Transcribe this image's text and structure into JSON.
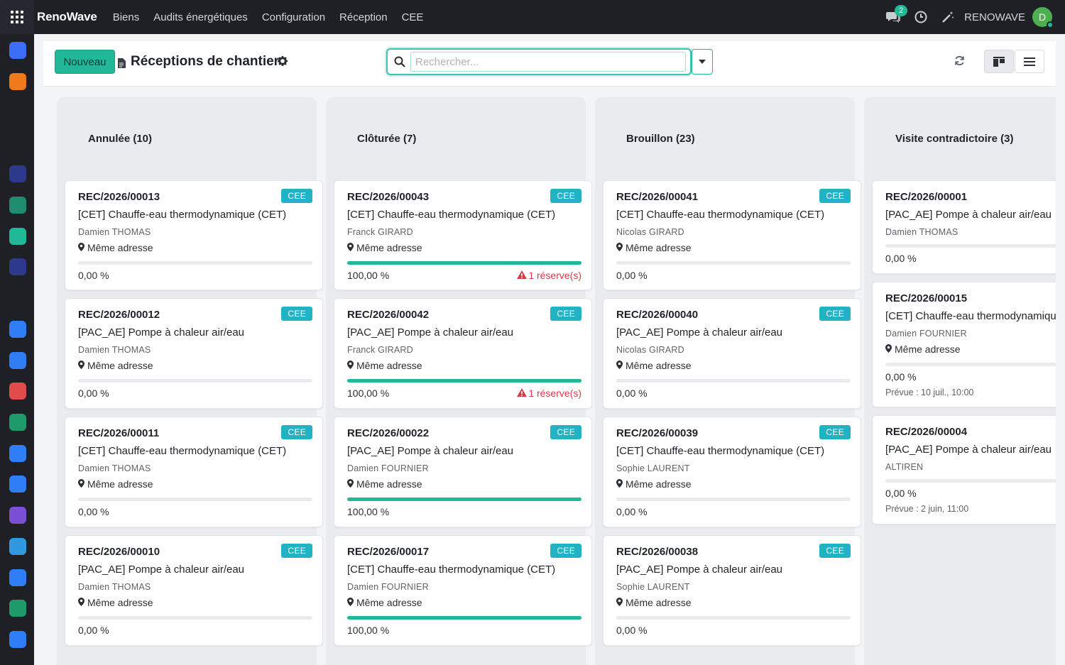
{
  "app": {
    "brand": "RenoWave",
    "menu": [
      "Biens",
      "Audits énergétiques",
      "Configuration",
      "Réception",
      "CEE"
    ],
    "messages_count": "2",
    "company": "RENOWAVE",
    "user_initial": "D"
  },
  "control": {
    "new_label": "Nouveau",
    "title": "Réceptions de chantier",
    "search_placeholder": "Rechercher..."
  },
  "columns": [
    {
      "title": "Annulée (10)",
      "cards": [
        {
          "ref": "REC/2026/00013",
          "tag": "CEE",
          "name": "[CET] Chauffe-eau thermodynamique (CET)",
          "person": "Damien THOMAS",
          "address": "Même adresse",
          "progress": 0,
          "progress_label": "0,00 %"
        },
        {
          "ref": "REC/2026/00012",
          "tag": "CEE",
          "name": "[PAC_AE] Pompe à chaleur air/eau",
          "person": "Damien THOMAS",
          "address": "Même adresse",
          "progress": 0,
          "progress_label": "0,00 %"
        },
        {
          "ref": "REC/2026/00011",
          "tag": "CEE",
          "name": "[CET] Chauffe-eau thermodynamique (CET)",
          "person": "Damien THOMAS",
          "address": "Même adresse",
          "progress": 0,
          "progress_label": "0,00 %"
        },
        {
          "ref": "REC/2026/00010",
          "tag": "CEE",
          "name": "[PAC_AE] Pompe à chaleur air/eau",
          "person": "Damien THOMAS",
          "address": "Même adresse",
          "progress": 0,
          "progress_label": "0,00 %"
        }
      ]
    },
    {
      "title": "Clôturée (7)",
      "cards": [
        {
          "ref": "REC/2026/00043",
          "tag": "CEE",
          "name": "[CET] Chauffe-eau thermodynamique (CET)",
          "person": "Franck GIRARD",
          "address": "Même adresse",
          "progress": 100,
          "progress_label": "100,00 %",
          "reserve": "1 réserve(s)"
        },
        {
          "ref": "REC/2026/00042",
          "tag": "CEE",
          "name": "[PAC_AE] Pompe à chaleur air/eau",
          "person": "Franck GIRARD",
          "address": "Même adresse",
          "progress": 100,
          "progress_label": "100,00 %",
          "reserve": "1 réserve(s)"
        },
        {
          "ref": "REC/2026/00022",
          "tag": "CEE",
          "name": "[PAC_AE] Pompe à chaleur air/eau",
          "person": "Damien FOURNIER",
          "address": "Même adresse",
          "progress": 100,
          "progress_label": "100,00 %"
        },
        {
          "ref": "REC/2026/00017",
          "tag": "CEE",
          "name": "[CET] Chauffe-eau thermodynamique (CET)",
          "person": "Damien FOURNIER",
          "address": "Même adresse",
          "progress": 100,
          "progress_label": "100,00 %"
        }
      ]
    },
    {
      "title": "Brouillon (23)",
      "cards": [
        {
          "ref": "REC/2026/00041",
          "tag": "CEE",
          "name": "[CET] Chauffe-eau thermodynamique (CET)",
          "person": "Nicolas GIRARD",
          "address": "Même adresse",
          "progress": 0,
          "progress_label": "0,00 %"
        },
        {
          "ref": "REC/2026/00040",
          "tag": "CEE",
          "name": "[PAC_AE] Pompe à chaleur air/eau",
          "person": "Nicolas GIRARD",
          "address": "Même adresse",
          "progress": 0,
          "progress_label": "0,00 %"
        },
        {
          "ref": "REC/2026/00039",
          "tag": "CEE",
          "name": "[CET] Chauffe-eau thermodynamique (CET)",
          "person": "Sophie LAURENT",
          "address": "Même adresse",
          "progress": 0,
          "progress_label": "0,00 %"
        },
        {
          "ref": "REC/2026/00038",
          "tag": "CEE",
          "name": "[PAC_AE] Pompe à chaleur air/eau",
          "person": "Sophie LAURENT",
          "address": "Même adresse",
          "progress": 0,
          "progress_label": "0,00 %"
        }
      ]
    },
    {
      "title": "Visite contradictoire (3)",
      "cards": [
        {
          "ref": "REC/2026/00001",
          "name": "[PAC_AE] Pompe à chaleur air/eau",
          "person": "Damien THOMAS",
          "progress": 0,
          "progress_label": "0,00 %"
        },
        {
          "ref": "REC/2026/00015",
          "name": "[CET] Chauffe-eau thermodynamique (CET)",
          "person": "Damien FOURNIER",
          "address": "Même adresse",
          "progress": 0,
          "progress_label": "0,00 %",
          "due": "Prévue : 10 juil., 10:00"
        },
        {
          "ref": "REC/2026/00004",
          "name": "[PAC_AE] Pompe à chaleur air/eau",
          "person": "ALTIREN",
          "progress": 0,
          "progress_label": "0,00 %",
          "due": "Prévue : 2 juin, 11:00"
        }
      ]
    }
  ],
  "colors": {
    "accent": "#21b799",
    "tag": "#21b3c4",
    "warning": "#d43c4b",
    "topbar": "#1e2026"
  },
  "sidebar_icons": [
    {
      "name": "discuss-app-icon",
      "color": "#3b6ef5"
    },
    {
      "name": "chat-app-icon",
      "color": "#f07a1a"
    },
    {
      "name": "calendar-31-app-icon",
      "color": "#1e2026"
    },
    {
      "name": "notes-app-icon",
      "color": "#1e2026"
    },
    {
      "name": "point-of-sale-app-icon",
      "color": "#2d3a8c"
    },
    {
      "name": "contacts-app-icon",
      "color": "#1f8c6f"
    },
    {
      "name": "diamond-app-icon",
      "color": "#21b799"
    },
    {
      "name": "record-app-icon",
      "color": "#2d3a8c"
    },
    {
      "name": "bank-app-icon",
      "color": "#1e2026"
    },
    {
      "name": "blue-app-icon",
      "color": "#2f7ef6"
    },
    {
      "name": "planning-app-icon",
      "color": "#2f7ef6"
    },
    {
      "name": "dashboard-app-icon",
      "color": "#e24b4b"
    },
    {
      "name": "green-app-icon",
      "color": "#1f9a6a"
    },
    {
      "name": "agenda-app-icon",
      "color": "#2f7ef6"
    },
    {
      "name": "square-app-icon",
      "color": "#2f7ef6"
    },
    {
      "name": "purple-app-icon",
      "color": "#7b4fd6"
    },
    {
      "name": "document-app-icon",
      "color": "#2f9ae0"
    },
    {
      "name": "team-app-icon",
      "color": "#2f7ef6"
    },
    {
      "name": "grid-app-icon",
      "color": "#1f9a6a"
    },
    {
      "name": "sign-app-icon",
      "color": "#2f7ef6"
    }
  ]
}
